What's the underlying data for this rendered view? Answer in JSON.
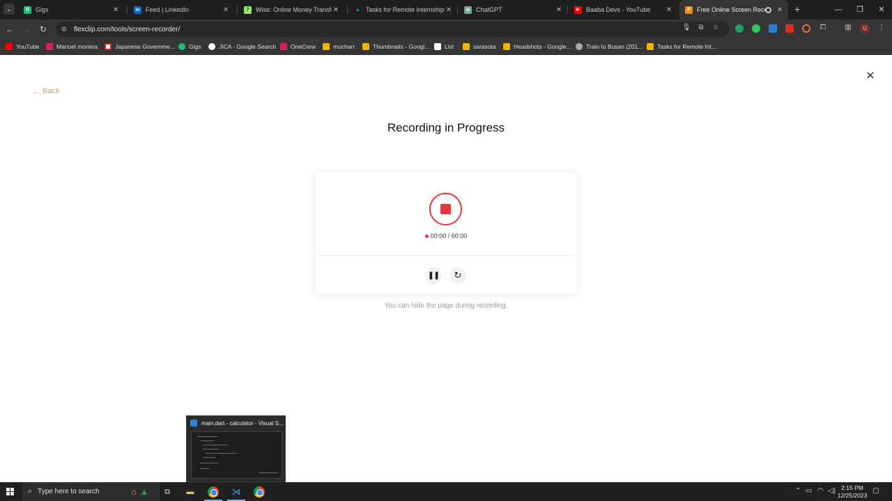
{
  "browser": {
    "tabs": [
      {
        "label": "Gigs",
        "favicon_color": "#1dbf73",
        "favicon_char": "fi"
      },
      {
        "label": "Feed | LinkedIn",
        "favicon_color": "#0a66c2",
        "favicon_char": "in"
      },
      {
        "label": "Wise: Online Money Transfers |",
        "favicon_color": "#9fe870",
        "favicon_char": "7"
      },
      {
        "label": "Tasks for Remote Internships -",
        "favicon_color": "#4285f4",
        "favicon_char": "▲"
      },
      {
        "label": "ChatGPT",
        "favicon_color": "#74aa9c",
        "favicon_char": "⊛"
      },
      {
        "label": "Baaba Devs - YouTube",
        "favicon_color": "#ff0000",
        "favicon_char": "▶"
      },
      {
        "label": "Free Online Screen Recorde",
        "favicon_color": "#f08a24",
        "favicon_char": "F",
        "active": true
      }
    ],
    "url": "flexclip.com/tools/screen-recorder/",
    "bookmarks": [
      {
        "label": "YouTube",
        "color": "#ff0000"
      },
      {
        "label": "Manuel moriera",
        "color": "#e01e5a"
      },
      {
        "label": "Japanese Governme...",
        "color": "#cc2222"
      },
      {
        "label": "Gigs",
        "color": "#1dbf73"
      },
      {
        "label": "JICA - Google Search",
        "color": "#4285f4"
      },
      {
        "label": "OneCrew",
        "color": "#e01e5a"
      },
      {
        "label": "mucharr",
        "color": "#f4b400"
      },
      {
        "label": "Thumbnails - Googl...",
        "color": "#f4b400"
      },
      {
        "label": "List",
        "color": "#ffffff"
      },
      {
        "label": "sarasota",
        "color": "#f4b400"
      },
      {
        "label": "Headshots - Google...",
        "color": "#f4b400"
      },
      {
        "label": "Train to Busan (201...",
        "color": "#aaaaaa"
      },
      {
        "label": "Tasks for Remote Int...",
        "color": "#f4b400"
      }
    ]
  },
  "page": {
    "back_label": "Back",
    "title": "Recording in Progress",
    "timer_text": "00:00 / 60:00",
    "hint": "You can hide the page during recording.",
    "accent_color": "#e8363b"
  },
  "taskbar": {
    "search_placeholder": "Type here to search",
    "thumbnail_title": "main.dart - calculator - Visual S...",
    "time": "2:15 PM",
    "date": "12/25/2023"
  }
}
